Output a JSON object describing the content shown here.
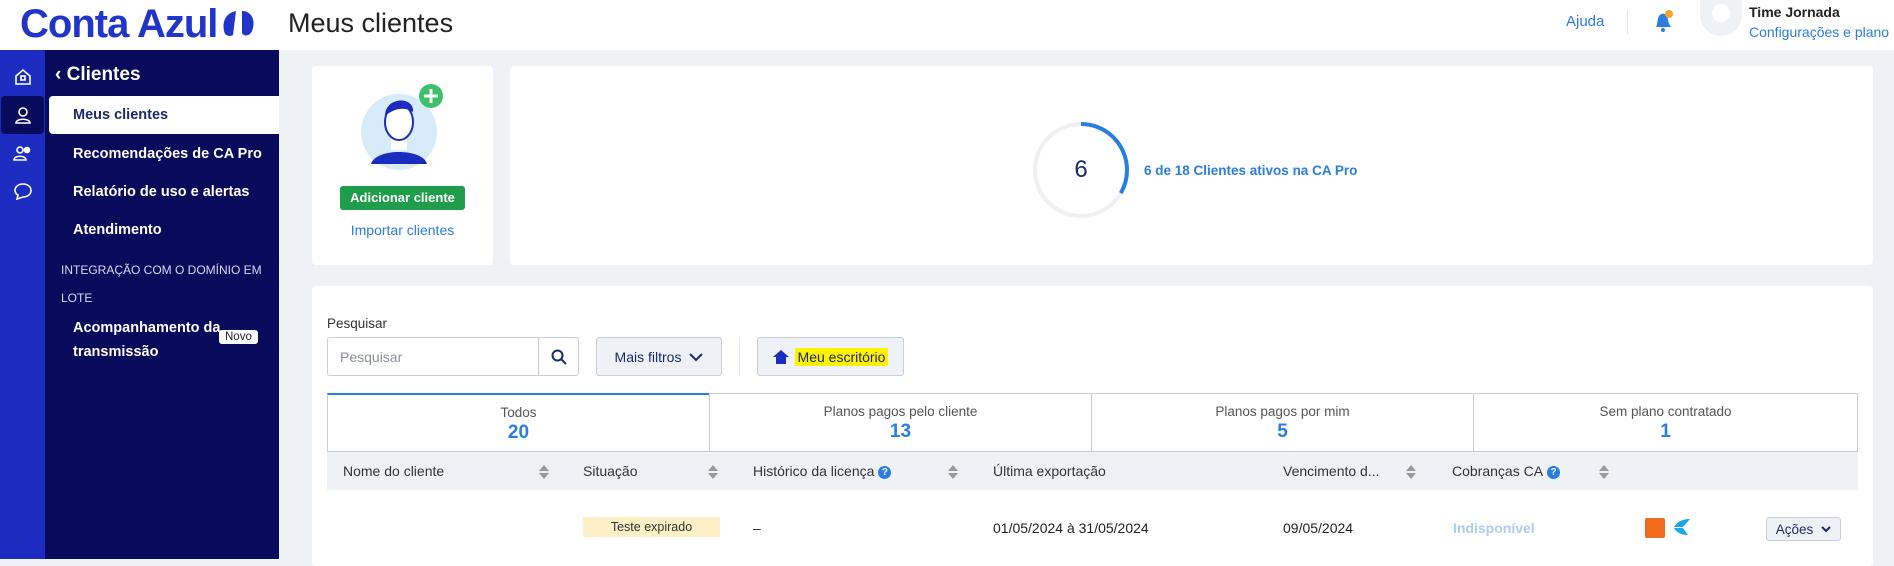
{
  "header": {
    "logo": "Conta Azul",
    "title": "Meus clientes",
    "help": "Ajuda",
    "user_name": "Time Jornada",
    "user_link": "Configurações e plano"
  },
  "rail": {
    "icons": [
      "home-icon",
      "user-icon",
      "users-icon",
      "chat-icon"
    ],
    "active": 1
  },
  "sidebar": {
    "title": "Clientes",
    "items": [
      {
        "label": "Meus clientes",
        "active": true
      },
      {
        "label": "Recomendações de CA Pro"
      },
      {
        "label": "Relatório de uso e alertas"
      },
      {
        "label": "Atendimento"
      }
    ],
    "section": "INTEGRAÇÃO COM O DOMÍNIO EM LOTE",
    "sub_item": "Acompanhamento da transmissão",
    "sub_badge": "Novo"
  },
  "add_card": {
    "add_label": "Adicionar cliente",
    "import_label": "Importar clientes"
  },
  "stats": {
    "active": 6,
    "total": 18,
    "active_value": "6",
    "label": "6 de 18 Clientes ativos na CA Pro",
    "ring_color": "#2a7de1"
  },
  "filters": {
    "search_label": "Pesquisar",
    "search_placeholder": "Pesquisar",
    "search_value": "",
    "more_filters": "Mais filtros",
    "my_office": "Meu escritório"
  },
  "tabs": [
    {
      "label": "Todos",
      "count": "20",
      "active": true
    },
    {
      "label": "Planos pagos pelo cliente",
      "count": "13"
    },
    {
      "label": "Planos pagos por mim",
      "count": "5"
    },
    {
      "label": "Sem plano contratado",
      "count": "1"
    }
  ],
  "table": {
    "columns": [
      "Nome do cliente",
      "Situação",
      "Histórico da licença",
      "Última exportação",
      "Vencimento d...",
      "Cobranças CA"
    ],
    "rows": [
      {
        "name": "",
        "status": "Teste expirado",
        "history": "–",
        "export": "01/05/2024 à 31/05/2024",
        "due": "09/05/2024",
        "billing": "Indisponível",
        "actions": "Ações"
      }
    ]
  }
}
